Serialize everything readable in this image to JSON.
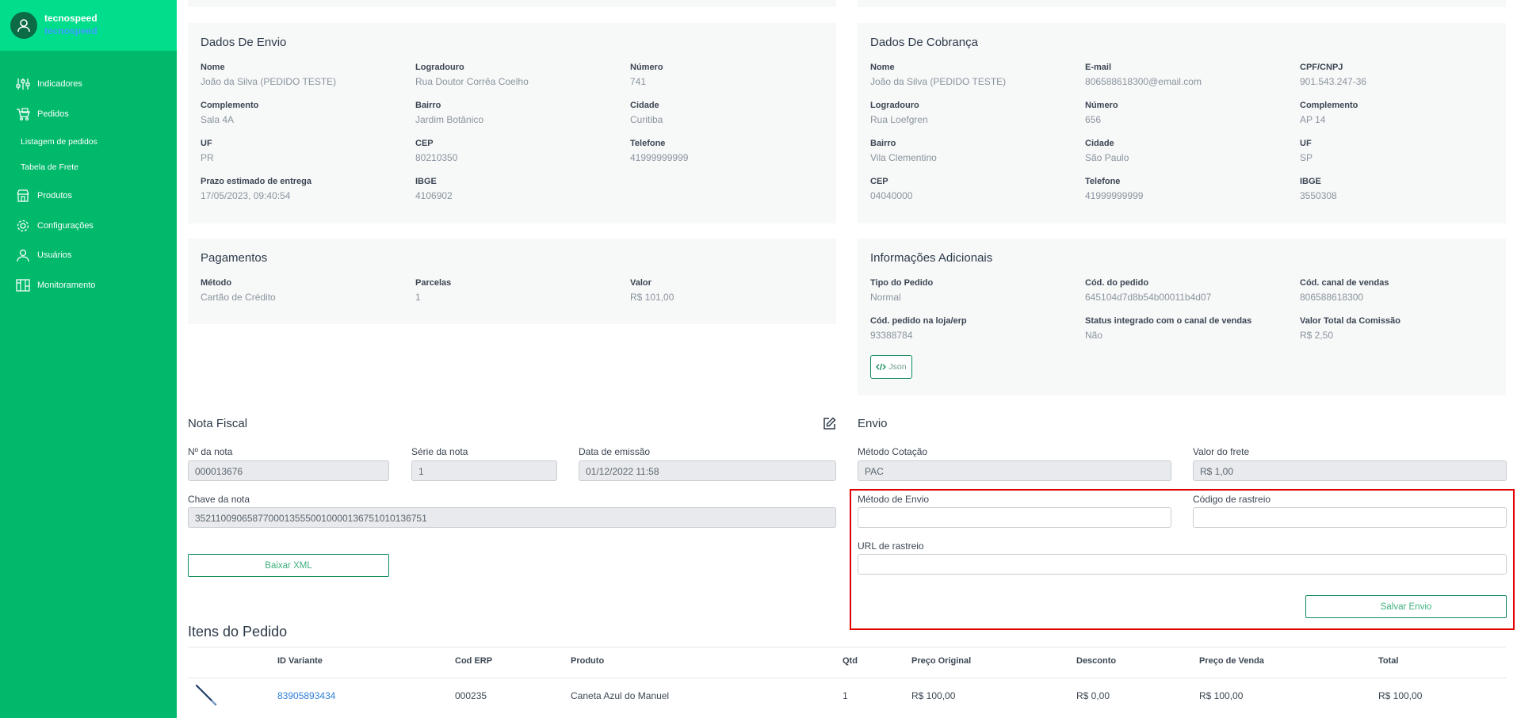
{
  "brand": {
    "name": "tecnospeed",
    "sub": "tecnospeed"
  },
  "sidebar": {
    "items": [
      {
        "label": "Indicadores",
        "icon": "sliders-icon"
      },
      {
        "label": "Pedidos",
        "icon": "orders-icon"
      },
      {
        "label": "Listagem de pedidos"
      },
      {
        "label": "Tabela de Frete"
      },
      {
        "label": "Produtos",
        "icon": "store-icon"
      },
      {
        "label": "Configurações",
        "icon": "gear-icon"
      },
      {
        "label": "Usuários",
        "icon": "user-icon"
      },
      {
        "label": "Monitoramento",
        "icon": "monitor-icon"
      }
    ]
  },
  "envio_card": {
    "title": "Dados De Envio",
    "fields": [
      {
        "label": "Nome",
        "value": "João da Silva (PEDIDO TESTE)"
      },
      {
        "label": "Logradouro",
        "value": "Rua Doutor Corrêa Coelho"
      },
      {
        "label": "Número",
        "value": "741"
      },
      {
        "label": "Complemento",
        "value": "Sala 4A"
      },
      {
        "label": "Bairro",
        "value": "Jardim Botânico"
      },
      {
        "label": "Cidade",
        "value": "Curitiba"
      },
      {
        "label": "UF",
        "value": "PR"
      },
      {
        "label": "CEP",
        "value": "80210350"
      },
      {
        "label": "Telefone",
        "value": "41999999999"
      },
      {
        "label": "Prazo estimado de entrega",
        "value": "17/05/2023, 09:40:54"
      },
      {
        "label": "IBGE",
        "value": "4106902"
      }
    ]
  },
  "cobranca_card": {
    "title": "Dados De Cobrança",
    "fields": [
      {
        "label": "Nome",
        "value": "João da Silva (PEDIDO TESTE)"
      },
      {
        "label": "E-mail",
        "value": "806588618300@email.com"
      },
      {
        "label": "CPF/CNPJ",
        "value": "901.543.247-36"
      },
      {
        "label": "Logradouro",
        "value": "Rua Loefgren"
      },
      {
        "label": "Número",
        "value": "656"
      },
      {
        "label": "Complemento",
        "value": "AP 14"
      },
      {
        "label": "Bairro",
        "value": "Vila Clementino"
      },
      {
        "label": "Cidade",
        "value": "São Paulo"
      },
      {
        "label": "UF",
        "value": "SP"
      },
      {
        "label": "CEP",
        "value": "04040000"
      },
      {
        "label": "Telefone",
        "value": "41999999999"
      },
      {
        "label": "IBGE",
        "value": "3550308"
      }
    ]
  },
  "pagamentos_card": {
    "title": "Pagamentos",
    "fields": [
      {
        "label": "Método",
        "value": "Cartão de Crédito"
      },
      {
        "label": "Parcelas",
        "value": "1"
      },
      {
        "label": "Valor",
        "value": "R$ 101,00"
      }
    ]
  },
  "adicionais_card": {
    "title": "Informações Adicionais",
    "fields": [
      {
        "label": "Tipo do Pedido",
        "value": "Normal"
      },
      {
        "label": "Cód. do pedido",
        "value": "645104d7d8b54b00011b4d07"
      },
      {
        "label": "Cód. canal de vendas",
        "value": "806588618300"
      },
      {
        "label": "Cód. pedido na loja/erp",
        "value": "93388784"
      },
      {
        "label": "Status integrado com o canal de vendas",
        "value": "Não"
      },
      {
        "label": "Valor Total da Comissão",
        "value": "R$ 2,50"
      }
    ],
    "json_label": "Json"
  },
  "nota_fiscal": {
    "title": "Nota Fiscal",
    "numero_label": "Nº da nota",
    "numero_value": "000013676",
    "serie_label": "Série da nota",
    "serie_value": "1",
    "data_label": "Data de emissão",
    "data_value": "01/12/2022 11:58",
    "chave_label": "Chave da nota",
    "chave_value": "35211009065877000135550010000136751010136751",
    "xml_button": "Baixar XML"
  },
  "envio": {
    "title": "Envio",
    "metodo_cotacao_label": "Método Cotação",
    "metodo_cotacao_value": "PAC",
    "valor_frete_label": "Valor do frete",
    "valor_frete_value": "R$ 1,00",
    "metodo_envio_label": "Método de Envio",
    "codigo_rastreio_label": "Código de rastreio",
    "url_rastreio_label": "URL de rastreio",
    "salvar_button": "Salvar Envio"
  },
  "itens": {
    "title": "Itens do Pedido",
    "headers": [
      "ID Variante",
      "Cod ERP",
      "Produto",
      "Qtd",
      "Preço Original",
      "Desconto",
      "Preço de Venda",
      "Total"
    ],
    "rows": [
      {
        "id_variante": "83905893434",
        "cod_erp": "000235",
        "produto": "Caneta Azul do Manuel",
        "qtd": "1",
        "preco_original": "R$ 100,00",
        "desconto": "R$ 0,00",
        "preco_venda": "R$ 100,00",
        "total": "R$ 100,00"
      }
    ]
  },
  "colors": {
    "sidebar": "#00b96b",
    "sidebar_top": "#00de8c",
    "accent": "#0e8a57",
    "link": "#2f7fd6",
    "highlight": "#e00000"
  }
}
